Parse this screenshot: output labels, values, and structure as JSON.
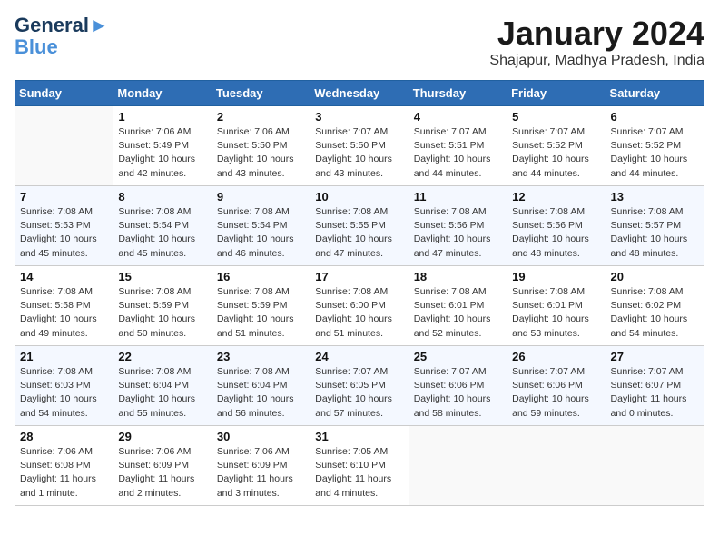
{
  "header": {
    "logo_line1": "General",
    "logo_line2": "Blue",
    "title": "January 2024",
    "subtitle": "Shajapur, Madhya Pradesh, India"
  },
  "days_of_week": [
    "Sunday",
    "Monday",
    "Tuesday",
    "Wednesday",
    "Thursday",
    "Friday",
    "Saturday"
  ],
  "weeks": [
    [
      {
        "num": "",
        "info": ""
      },
      {
        "num": "1",
        "info": "Sunrise: 7:06 AM\nSunset: 5:49 PM\nDaylight: 10 hours\nand 42 minutes."
      },
      {
        "num": "2",
        "info": "Sunrise: 7:06 AM\nSunset: 5:50 PM\nDaylight: 10 hours\nand 43 minutes."
      },
      {
        "num": "3",
        "info": "Sunrise: 7:07 AM\nSunset: 5:50 PM\nDaylight: 10 hours\nand 43 minutes."
      },
      {
        "num": "4",
        "info": "Sunrise: 7:07 AM\nSunset: 5:51 PM\nDaylight: 10 hours\nand 44 minutes."
      },
      {
        "num": "5",
        "info": "Sunrise: 7:07 AM\nSunset: 5:52 PM\nDaylight: 10 hours\nand 44 minutes."
      },
      {
        "num": "6",
        "info": "Sunrise: 7:07 AM\nSunset: 5:52 PM\nDaylight: 10 hours\nand 44 minutes."
      }
    ],
    [
      {
        "num": "7",
        "info": "Sunrise: 7:08 AM\nSunset: 5:53 PM\nDaylight: 10 hours\nand 45 minutes."
      },
      {
        "num": "8",
        "info": "Sunrise: 7:08 AM\nSunset: 5:54 PM\nDaylight: 10 hours\nand 45 minutes."
      },
      {
        "num": "9",
        "info": "Sunrise: 7:08 AM\nSunset: 5:54 PM\nDaylight: 10 hours\nand 46 minutes."
      },
      {
        "num": "10",
        "info": "Sunrise: 7:08 AM\nSunset: 5:55 PM\nDaylight: 10 hours\nand 47 minutes."
      },
      {
        "num": "11",
        "info": "Sunrise: 7:08 AM\nSunset: 5:56 PM\nDaylight: 10 hours\nand 47 minutes."
      },
      {
        "num": "12",
        "info": "Sunrise: 7:08 AM\nSunset: 5:56 PM\nDaylight: 10 hours\nand 48 minutes."
      },
      {
        "num": "13",
        "info": "Sunrise: 7:08 AM\nSunset: 5:57 PM\nDaylight: 10 hours\nand 48 minutes."
      }
    ],
    [
      {
        "num": "14",
        "info": "Sunrise: 7:08 AM\nSunset: 5:58 PM\nDaylight: 10 hours\nand 49 minutes."
      },
      {
        "num": "15",
        "info": "Sunrise: 7:08 AM\nSunset: 5:59 PM\nDaylight: 10 hours\nand 50 minutes."
      },
      {
        "num": "16",
        "info": "Sunrise: 7:08 AM\nSunset: 5:59 PM\nDaylight: 10 hours\nand 51 minutes."
      },
      {
        "num": "17",
        "info": "Sunrise: 7:08 AM\nSunset: 6:00 PM\nDaylight: 10 hours\nand 51 minutes."
      },
      {
        "num": "18",
        "info": "Sunrise: 7:08 AM\nSunset: 6:01 PM\nDaylight: 10 hours\nand 52 minutes."
      },
      {
        "num": "19",
        "info": "Sunrise: 7:08 AM\nSunset: 6:01 PM\nDaylight: 10 hours\nand 53 minutes."
      },
      {
        "num": "20",
        "info": "Sunrise: 7:08 AM\nSunset: 6:02 PM\nDaylight: 10 hours\nand 54 minutes."
      }
    ],
    [
      {
        "num": "21",
        "info": "Sunrise: 7:08 AM\nSunset: 6:03 PM\nDaylight: 10 hours\nand 54 minutes."
      },
      {
        "num": "22",
        "info": "Sunrise: 7:08 AM\nSunset: 6:04 PM\nDaylight: 10 hours\nand 55 minutes."
      },
      {
        "num": "23",
        "info": "Sunrise: 7:08 AM\nSunset: 6:04 PM\nDaylight: 10 hours\nand 56 minutes."
      },
      {
        "num": "24",
        "info": "Sunrise: 7:07 AM\nSunset: 6:05 PM\nDaylight: 10 hours\nand 57 minutes."
      },
      {
        "num": "25",
        "info": "Sunrise: 7:07 AM\nSunset: 6:06 PM\nDaylight: 10 hours\nand 58 minutes."
      },
      {
        "num": "26",
        "info": "Sunrise: 7:07 AM\nSunset: 6:06 PM\nDaylight: 10 hours\nand 59 minutes."
      },
      {
        "num": "27",
        "info": "Sunrise: 7:07 AM\nSunset: 6:07 PM\nDaylight: 11 hours\nand 0 minutes."
      }
    ],
    [
      {
        "num": "28",
        "info": "Sunrise: 7:06 AM\nSunset: 6:08 PM\nDaylight: 11 hours\nand 1 minute."
      },
      {
        "num": "29",
        "info": "Sunrise: 7:06 AM\nSunset: 6:09 PM\nDaylight: 11 hours\nand 2 minutes."
      },
      {
        "num": "30",
        "info": "Sunrise: 7:06 AM\nSunset: 6:09 PM\nDaylight: 11 hours\nand 3 minutes."
      },
      {
        "num": "31",
        "info": "Sunrise: 7:05 AM\nSunset: 6:10 PM\nDaylight: 11 hours\nand 4 minutes."
      },
      {
        "num": "",
        "info": ""
      },
      {
        "num": "",
        "info": ""
      },
      {
        "num": "",
        "info": ""
      }
    ]
  ]
}
